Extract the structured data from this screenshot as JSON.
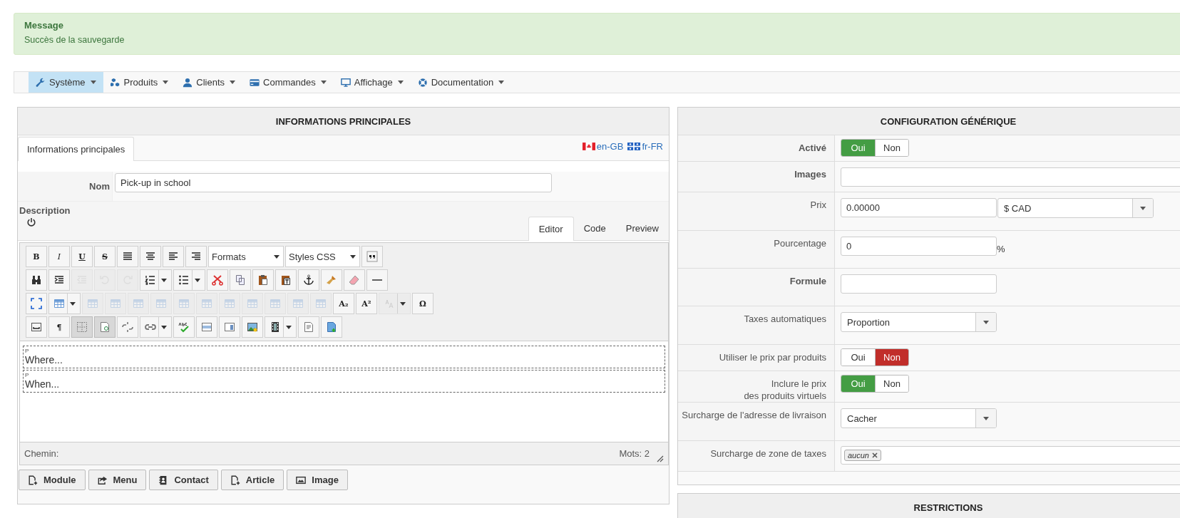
{
  "alert": {
    "title": "Message",
    "text": "Succès de la sauvegarde"
  },
  "menu": [
    {
      "label": "Système",
      "selected": true
    },
    {
      "label": "Produits",
      "selected": false
    },
    {
      "label": "Clients",
      "selected": false
    },
    {
      "label": "Commandes",
      "selected": false
    },
    {
      "label": "Affichage",
      "selected": false
    },
    {
      "label": "Documentation",
      "selected": false
    }
  ],
  "main_panel": {
    "title": "INFORMATIONS PRINCIPALES",
    "tabs": [
      {
        "label": "Informations principales",
        "selected": true
      }
    ],
    "languages": [
      {
        "label": "en-GB"
      },
      {
        "label": "fr-FR"
      }
    ],
    "name": {
      "label": "Nom",
      "value": "Pick-up in school"
    },
    "description": {
      "label": "Description",
      "editor_tabs": [
        {
          "label": "Editor",
          "selected": true
        },
        {
          "label": "Code",
          "selected": false
        },
        {
          "label": "Preview",
          "selected": false
        }
      ],
      "toolbar": [
        [
          {
            "kind": "button",
            "label": "B",
            "disabled": false,
            "active": false
          },
          {
            "kind": "button",
            "label": "I",
            "disabled": false,
            "active": false
          },
          {
            "kind": "button",
            "label": "U",
            "disabled": false,
            "active": false
          },
          {
            "kind": "button",
            "label": "S",
            "disabled": false,
            "active": false
          },
          {
            "kind": "button",
            "disabled": false,
            "active": false
          },
          {
            "kind": "button",
            "disabled": false,
            "active": false
          },
          {
            "kind": "button",
            "disabled": false,
            "active": false
          },
          {
            "kind": "button",
            "disabled": false,
            "active": false
          },
          {
            "kind": "select",
            "value": "Formats"
          },
          {
            "kind": "select",
            "value": "Styles CSS"
          },
          {
            "kind": "button",
            "disabled": false,
            "active": false
          }
        ],
        [
          {
            "kind": "button",
            "disabled": false,
            "active": false
          },
          {
            "kind": "button",
            "disabled": false,
            "active": false
          },
          {
            "kind": "button",
            "disabled": true,
            "active": false
          },
          {
            "kind": "button",
            "disabled": true,
            "active": false
          },
          {
            "kind": "button",
            "disabled": true,
            "active": false
          },
          {
            "kind": "split",
            "disabled": false,
            "active": false
          },
          {
            "kind": "split",
            "disabled": false,
            "active": false
          },
          {
            "kind": "button",
            "disabled": false,
            "active": false
          },
          {
            "kind": "button",
            "disabled": false,
            "active": false
          },
          {
            "kind": "button",
            "disabled": false,
            "active": false
          },
          {
            "kind": "button",
            "disabled": false,
            "active": false
          },
          {
            "kind": "button",
            "disabled": false,
            "active": false
          },
          {
            "kind": "button",
            "disabled": false,
            "active": false
          },
          {
            "kind": "button",
            "disabled": false,
            "active": false
          },
          {
            "kind": "button",
            "disabled": false,
            "active": false
          }
        ],
        [
          {
            "kind": "button",
            "disabled": false,
            "active": false
          },
          {
            "kind": "split",
            "disabled": false,
            "active": false
          },
          {
            "kind": "button",
            "disabled": true,
            "active": false
          },
          {
            "kind": "button",
            "disabled": true,
            "active": false
          },
          {
            "kind": "button",
            "disabled": true,
            "active": false
          },
          {
            "kind": "button",
            "disabled": true,
            "active": false
          },
          {
            "kind": "button",
            "disabled": true,
            "active": false
          },
          {
            "kind": "button",
            "disabled": true,
            "active": false
          },
          {
            "kind": "button",
            "disabled": true,
            "active": false
          },
          {
            "kind": "button",
            "disabled": true,
            "active": false
          },
          {
            "kind": "button",
            "disabled": true,
            "active": false
          },
          {
            "kind": "button",
            "disabled": true,
            "active": false
          },
          {
            "kind": "button",
            "disabled": true,
            "active": false
          },
          {
            "kind": "button",
            "label": "A₂",
            "disabled": false,
            "active": false
          },
          {
            "kind": "button",
            "label": "A²",
            "disabled": false,
            "active": false
          },
          {
            "kind": "split",
            "disabled": true,
            "active": false
          },
          {
            "kind": "button",
            "label": "Ω",
            "disabled": false,
            "active": false
          }
        ],
        [
          {
            "kind": "button",
            "disabled": false,
            "active": false
          },
          {
            "kind": "button",
            "label": "¶",
            "disabled": false,
            "active": false
          },
          {
            "kind": "button",
            "disabled": false,
            "active": true
          },
          {
            "kind": "button",
            "disabled": false,
            "active": true
          },
          {
            "kind": "button",
            "disabled": false,
            "active": false
          },
          {
            "kind": "split",
            "disabled": false,
            "active": false
          },
          {
            "kind": "button",
            "disabled": false,
            "active": false
          },
          {
            "kind": "button",
            "disabled": false,
            "active": false
          },
          {
            "kind": "button",
            "disabled": false,
            "active": false
          },
          {
            "kind": "button",
            "disabled": false,
            "active": false
          },
          {
            "kind": "split",
            "disabled": false,
            "active": false
          },
          {
            "kind": "button",
            "disabled": false,
            "active": false
          },
          {
            "kind": "button",
            "disabled": false,
            "active": false
          }
        ]
      ],
      "paragraphs": [
        {
          "tag": "P",
          "text": "Where..."
        },
        {
          "tag": "P",
          "text": "When..."
        }
      ],
      "path_label": "Chemin:",
      "word_count": "Mots: 2"
    },
    "buttons": [
      {
        "label": "Module"
      },
      {
        "label": "Menu"
      },
      {
        "label": "Contact"
      },
      {
        "label": "Article"
      },
      {
        "label": "Image"
      }
    ]
  },
  "config_panel": {
    "title": "CONFIGURATION GÉNÉRIQUE",
    "rows": [
      {
        "kind": "toggle",
        "label": "Activé",
        "emphasized": true,
        "options": [
          {
            "label": "Oui",
            "selected": true
          },
          {
            "label": "Non",
            "selected": false
          }
        ]
      },
      {
        "kind": "input",
        "label": "Images",
        "emphasized": true,
        "wide": true
      },
      {
        "kind": "price",
        "label": "Prix",
        "emphasized": false,
        "value": "0.00000",
        "currency": "$ CAD"
      },
      {
        "kind": "percent",
        "label": "Pourcentage",
        "emphasized": false,
        "value": "0",
        "suffix": "%"
      },
      {
        "kind": "input",
        "label": "Formule",
        "emphasized": true,
        "wide": false
      },
      {
        "kind": "select",
        "label": "Taxes automatiques",
        "emphasized": false,
        "value": "Proportion"
      },
      {
        "kind": "toggle",
        "label": "Utiliser le prix par produits",
        "emphasized": false,
        "options": [
          {
            "label": "Oui",
            "selected": false
          },
          {
            "label": "Non",
            "selected": true
          }
        ]
      },
      {
        "kind": "toggle",
        "label": "Inclure le prix\ndes produits virtuels",
        "emphasized": false,
        "options": [
          {
            "label": "Oui",
            "selected": true
          },
          {
            "label": "Non",
            "selected": false
          }
        ]
      },
      {
        "kind": "select",
        "label": "Surcharge de l'adresse de livraison",
        "emphasized": false,
        "value": "Cacher"
      },
      {
        "kind": "tags",
        "label": "Surcharge de zone de taxes",
        "emphasized": false,
        "tags": [
          "aucun"
        ]
      }
    ]
  },
  "restrictions_panel": {
    "title": "RESTRICTIONS"
  }
}
